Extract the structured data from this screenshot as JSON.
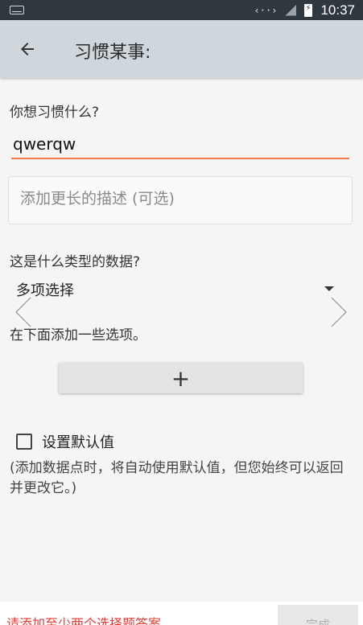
{
  "status_bar": {
    "code_indicator": "‹··›",
    "time": "10:37"
  },
  "app_bar": {
    "title": "习惯某事:",
    "back_icon": "arrow-left-icon"
  },
  "form": {
    "name_label": "你想习惯什么?",
    "name_value": "qwerqw",
    "description_placeholder": "添加更长的描述 (可选)",
    "type_label": "这是什么类型的数据?",
    "type_value": "多项选择",
    "options_label": "在下面添加一些选项。",
    "add_option": "+",
    "default_checkbox_label": "设置默认值",
    "default_checked": false,
    "default_hint": "(添加数据点时，将自动使用默认值，但您始终可以返回并更改它。)"
  },
  "footer": {
    "warning": "请添加至少两个选择题答案",
    "done_label": "完成"
  },
  "colors": {
    "accent": "#ef7b50",
    "warning": "#e53935",
    "app_bar": "#cfd6dc",
    "status_bar": "#30383f"
  }
}
